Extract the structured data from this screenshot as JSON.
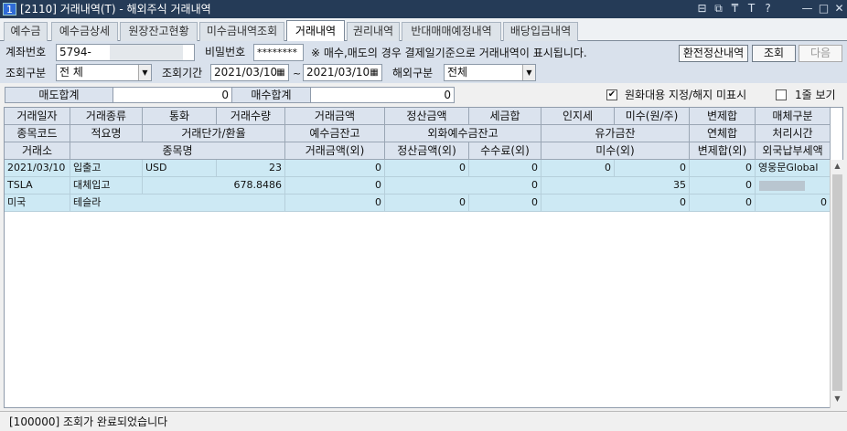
{
  "window": {
    "number": "1",
    "title": "[2110] 거래내역(T) - 해외주식 거래내역",
    "controls": [
      "⊟",
      "⧉",
      "₸",
      "T",
      "?",
      "—",
      "□",
      "✕"
    ]
  },
  "tabs": [
    "예수금",
    "예수금상세",
    "원장잔고현황",
    "미수금내역조회",
    "거래내역",
    "권리내역",
    "반대매매예정내역",
    "배당입금내역"
  ],
  "active_tab": "거래내역",
  "form": {
    "account_label": "계좌번호",
    "account_value": "5794-",
    "password_label": "비밀번호",
    "password_value": "********",
    "notice": "※ 매수,매도의 경우 결제일기준으로 거래내역이 표시됩니다.",
    "exchange_settle_button": "환전정산내역",
    "query_button": "조회",
    "next_button": "다음",
    "query_type_label": "조회구분",
    "query_type_value": "전 체",
    "period_label": "조회기간",
    "date_from": "2021/03/10",
    "date_sep": "~",
    "date_to": "2021/03/10",
    "overseas_label": "해외구분",
    "overseas_value": "전체"
  },
  "summary": {
    "sell_total_label": "매도합계",
    "sell_total_value": "0",
    "buy_total_label": "매수합계",
    "buy_total_value": "0",
    "krw_substitute_label": "원화대용 지정/해지 미표시",
    "krw_substitute_checked": true,
    "one_row_label": "1줄 보기",
    "one_row_checked": false
  },
  "grid": {
    "header_row1": [
      "거래일자",
      "거래종류",
      "통화",
      "거래수량",
      "거래금액",
      "정산금액",
      "세금합",
      "인지세",
      "미수(원/주)",
      "변제합",
      "매체구분"
    ],
    "header_row2": [
      "종목코드",
      "적요명",
      "거래단가/환율",
      "예수금잔고",
      "외화예수금잔고",
      "유가금잔",
      "연체합",
      "처리시간"
    ],
    "header_row3": [
      "거래소",
      "종목명",
      "거래금액(외)",
      "정산금액(외)",
      "수수료(외)",
      "미수(외)",
      "변제합(외)",
      "외국납부세액"
    ],
    "row1": [
      "2021/03/10",
      "입출고",
      "USD",
      "23",
      "0",
      "0",
      "0",
      "0",
      "0",
      "0",
      "영웅문Global"
    ],
    "row2": [
      "TSLA",
      "대체입고",
      "678.8486",
      "0",
      "0",
      "35",
      "0"
    ],
    "row3": [
      "미국",
      "테슬라",
      "0",
      "0",
      "0",
      "0",
      "0",
      "0"
    ]
  },
  "status": {
    "message": "[100000] 조회가 완료되었습니다"
  }
}
